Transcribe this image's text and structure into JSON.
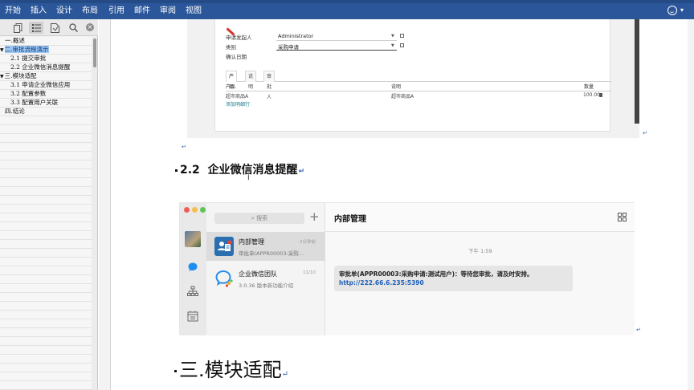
{
  "ribbon": {
    "tabs": [
      "开始",
      "插入",
      "设计",
      "布局",
      "引用",
      "邮件",
      "审阅",
      "视图"
    ]
  },
  "nav": {
    "items": [
      {
        "label": "一.概述",
        "level": 0
      },
      {
        "label": "二.审批流程演示",
        "level": 0,
        "selected": true,
        "arrow": "▼"
      },
      {
        "label": "2.1 提交审批",
        "level": 1
      },
      {
        "label": "2.2 企业微信消息提醒",
        "level": 1
      },
      {
        "label": "三.模块适配",
        "level": 0,
        "arrow": "▼"
      },
      {
        "label": "3.1 申请企业微信应用",
        "level": 1
      },
      {
        "label": "3.2 配置参数",
        "level": 1
      },
      {
        "label": "3.3 配置用户关联",
        "level": 1
      },
      {
        "label": "四.结论",
        "level": 0
      }
    ]
  },
  "form": {
    "applicant_label": "申请发起人",
    "applicant_value": "Administrator",
    "category_label": "类别",
    "category_value": "采购申请",
    "confirm_date_label": "确认日期",
    "tabs": [
      "产品",
      "说明",
      "审批人"
    ],
    "columns": [
      "产品",
      "说明",
      "数量"
    ],
    "rows": [
      [
        "超市商品A",
        "超市商品A",
        "100.00"
      ]
    ],
    "add_line": "添加明细行"
  },
  "doc": {
    "heading22_num": "2.2",
    "heading22_text": "企业微信消息提醒",
    "heading3": "三.模块适配",
    "para_mark": "↵"
  },
  "wecom": {
    "search_placeholder": "搜索",
    "plus": "+",
    "conversations": [
      {
        "name": "内部管理",
        "time": "2分钟前",
        "preview": "审批单(APPR00003:采购…",
        "active": true
      },
      {
        "name": "企业微信团队",
        "time": "11/10",
        "preview": "3.0.36 版本新功能介绍",
        "active": false
      }
    ],
    "chat_title": "内部管理",
    "msg_time": "下午 1:59",
    "msg_text": "审批单(APPR00003:采购申请:测试用户)：等待您审批，请及时安排。",
    "msg_link": "http://222.66.6.235:5390"
  },
  "colors": {
    "ribbon": "#2b579a",
    "nav_selected": "#9ec6f2",
    "link": "#1f5fb8",
    "traffic_red": "#ec5f57",
    "traffic_yellow": "#f4be4f",
    "traffic_green": "#5fc454"
  }
}
